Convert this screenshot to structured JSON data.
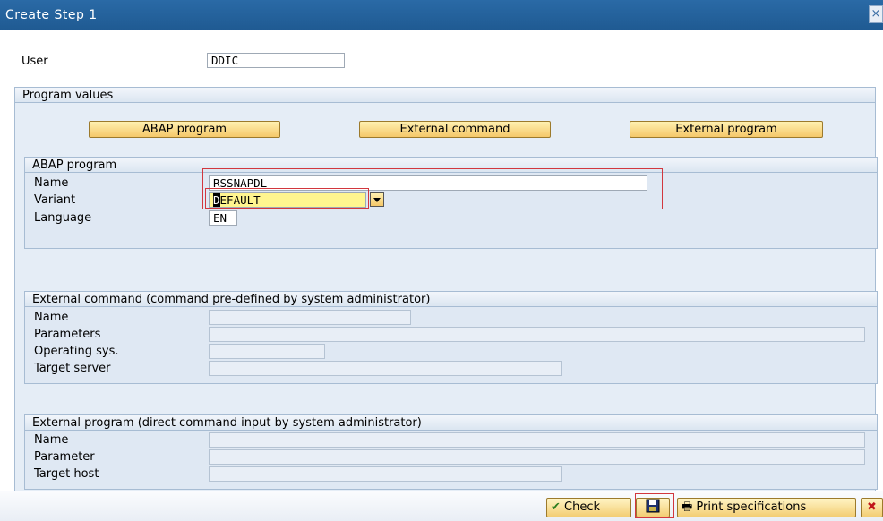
{
  "window": {
    "title": "Create Step  1"
  },
  "user": {
    "label": "User",
    "value": "DDIC"
  },
  "program_values": {
    "title": "Program values",
    "buttons": {
      "abap": "ABAP program",
      "external_command": "External command",
      "external_program": "External program"
    }
  },
  "abap_program": {
    "title": "ABAP program",
    "name_label": "Name",
    "name_value": "RSSNAPDL",
    "variant_label": "Variant",
    "variant_first_char": "D",
    "variant_rest": "EFAULT",
    "language_label": "Language",
    "language_value": "EN"
  },
  "external_command": {
    "title": "External command (command pre-defined by system administrator)",
    "name_label": "Name",
    "parameters_label": "Parameters",
    "os_label": "Operating sys.",
    "target_server_label": "Target server"
  },
  "external_program": {
    "title": "External program (direct command input by system administrator)",
    "name_label": "Name",
    "parameter_label": "Parameter",
    "target_host_label": "Target host"
  },
  "footer": {
    "check_label": "Check",
    "print_label": "Print specifications"
  },
  "colors": {
    "titlebar": "#1f5a92",
    "group_bg": "#e5edf6",
    "button": "#f5c86a",
    "highlight": "#d2373e"
  }
}
